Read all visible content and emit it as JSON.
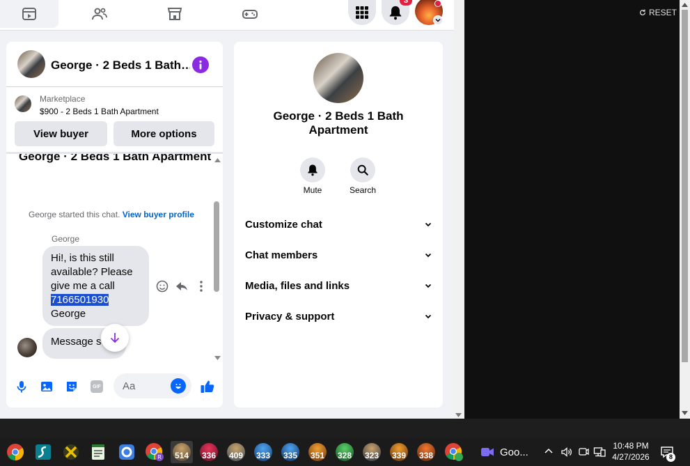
{
  "nav": {
    "badge_count": "3"
  },
  "chat": {
    "title": "George · 2 Beds 1 Bath…",
    "listing_source": "Marketplace",
    "listing_desc": "$900 - 2 Beds 1 Bath Apartment",
    "view_buyer": "View buyer",
    "more_options": "More options",
    "convo_title": "George · 2 Beds 1 Bath Apartment",
    "started_text": "George started this chat.",
    "view_profile": "View buyer profile",
    "sender": "George",
    "msg_line1": "Hi!, is this still",
    "msg_line2": "available? Please",
    "msg_line3": "give me a call",
    "msg_phone": "7166501930",
    "msg_line5": "George",
    "msg2": "Message s",
    "input_placeholder": "Aa",
    "gif_label": "GIF"
  },
  "info": {
    "name_line1": "George · 2 Beds 1 Bath",
    "name_line2": "Apartment",
    "mute": "Mute",
    "search": "Search",
    "sections": [
      "Customize chat",
      "Chat members",
      "Media, files and links",
      "Privacy & support"
    ]
  },
  "reset": "RESET",
  "taskbar": {
    "games": [
      "514",
      "336",
      "409",
      "333",
      "335",
      "351",
      "328",
      "323",
      "339",
      "338"
    ],
    "google_label": "Goo...",
    "time": "10:48 PM",
    "date": "4/27/2026",
    "notif_count": "8"
  },
  "colors": {
    "accent": "#0866ff",
    "purple": "#8a2be2",
    "select": "#1a4ecf"
  }
}
